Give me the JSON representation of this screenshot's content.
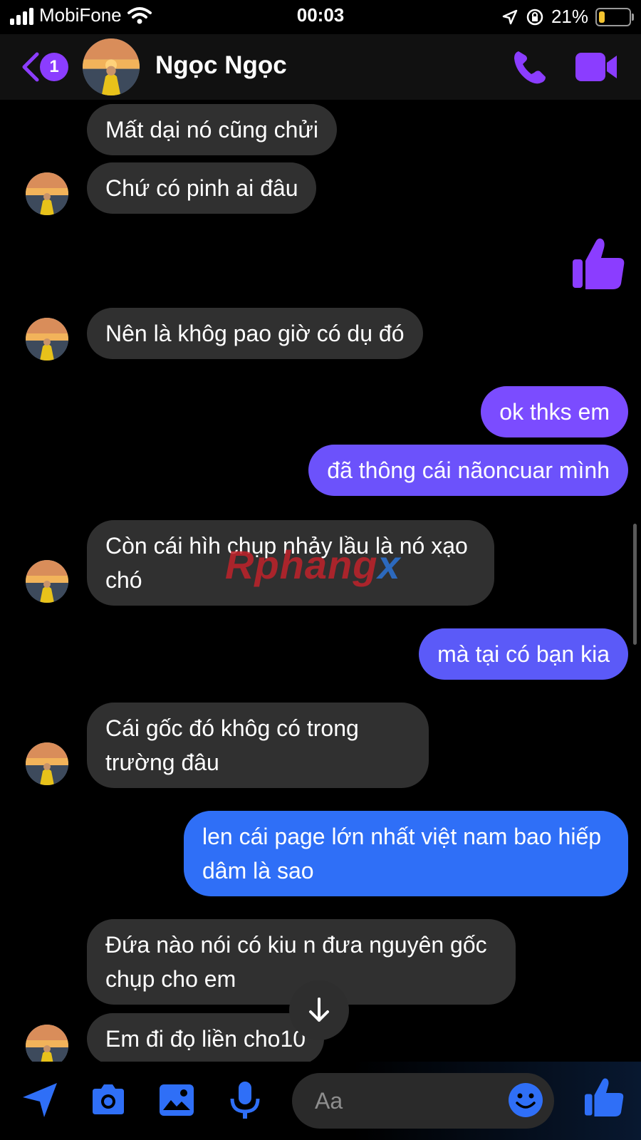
{
  "status_bar": {
    "carrier": "MobiFone",
    "time": "00:03",
    "battery": "21%",
    "battery_level": 0.21
  },
  "header": {
    "back_count": "1",
    "contact_name": "Ngọc Ngọc"
  },
  "messages": [
    {
      "from": "in",
      "text": "Mất dại nó cũng chửi"
    },
    {
      "from": "in",
      "text": "Chứ có pinh ai đâu"
    },
    {
      "from": "out",
      "type": "like"
    },
    {
      "from": "in",
      "text": "Nên là khôg pao giờ có dụ đó"
    },
    {
      "from": "out",
      "text": "ok thks em"
    },
    {
      "from": "out",
      "text": "đã thông cái nãoncuar mình"
    },
    {
      "from": "in",
      "text": "Còn cái hìh chụp nhảy lầu là nó xạo chó"
    },
    {
      "from": "out",
      "text": "mà tại có bạn kia"
    },
    {
      "from": "in",
      "text": "Cái gốc đó khôg có trong trường đâu"
    },
    {
      "from": "out",
      "text": "len cái page lớn nhất việt nam bao hiếp dâm là sao"
    },
    {
      "from": "in",
      "text": "Đứa nào nói có kiu n đưa nguyên gốc chụp cho em"
    },
    {
      "from": "in",
      "text": "Em đi đọ liền cho10"
    }
  ],
  "watermark": {
    "part1": "Rphang",
    "part2": "x"
  },
  "composer": {
    "placeholder": "Aa"
  },
  "colors": {
    "accent": "#8b3dff",
    "out_top": "#7b4cff",
    "out_bottom": "#2f6ff7",
    "incoming": "#303030"
  },
  "icons": [
    "back-chevron-icon",
    "phone-icon",
    "video-camera-icon",
    "thumbs-up-icon",
    "send-arrow-icon",
    "camera-icon",
    "gallery-icon",
    "microphone-icon",
    "emoji-icon",
    "arrow-down-icon"
  ]
}
